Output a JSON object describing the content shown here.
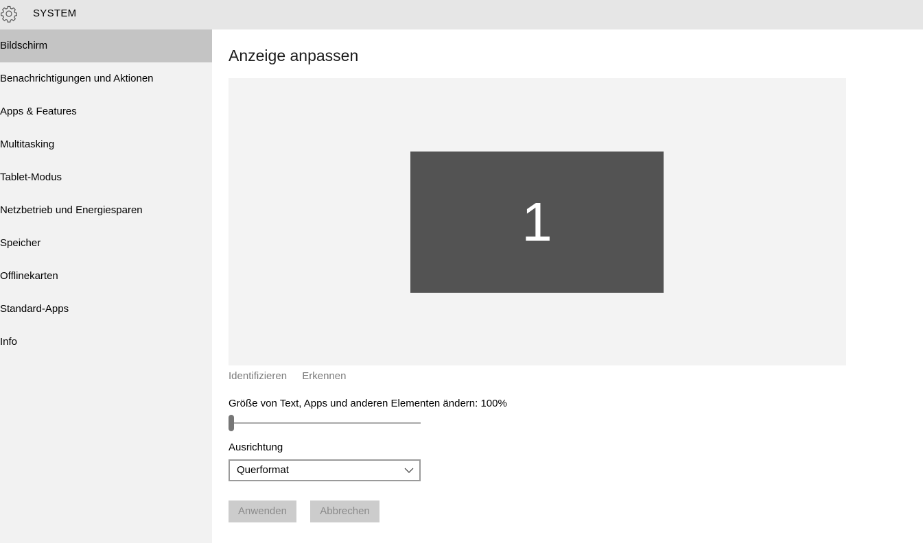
{
  "titlebar": {
    "title": "SYSTEM",
    "icon": "gear-icon"
  },
  "sidebar": {
    "items": [
      {
        "label": "Bildschirm",
        "selected": true
      },
      {
        "label": "Benachrichtigungen und Aktionen"
      },
      {
        "label": "Apps & Features"
      },
      {
        "label": "Multitasking"
      },
      {
        "label": "Tablet-Modus"
      },
      {
        "label": "Netzbetrieb und Energiesparen"
      },
      {
        "label": "Speicher"
      },
      {
        "label": "Offlinekarten"
      },
      {
        "label": "Standard-Apps"
      },
      {
        "label": "Info"
      }
    ]
  },
  "main": {
    "title": "Anzeige anpassen",
    "monitor_number": "1",
    "links": {
      "identify": "Identifizieren",
      "detect": "Erkennen"
    },
    "scale": {
      "label": "Größe von Text, Apps und anderen Elementen ändern: 100%",
      "value_fraction": 0
    },
    "orientation": {
      "label": "Ausrichtung",
      "selected": "Querformat"
    },
    "buttons": {
      "apply": "Anwenden",
      "cancel": "Abbrechen"
    }
  },
  "colors": {
    "selected_nav": "#c4c4c4",
    "sidebar_bg": "#f2f2f2",
    "monitor_bg": "#535353",
    "disabled_button_bg": "#cccccc"
  }
}
